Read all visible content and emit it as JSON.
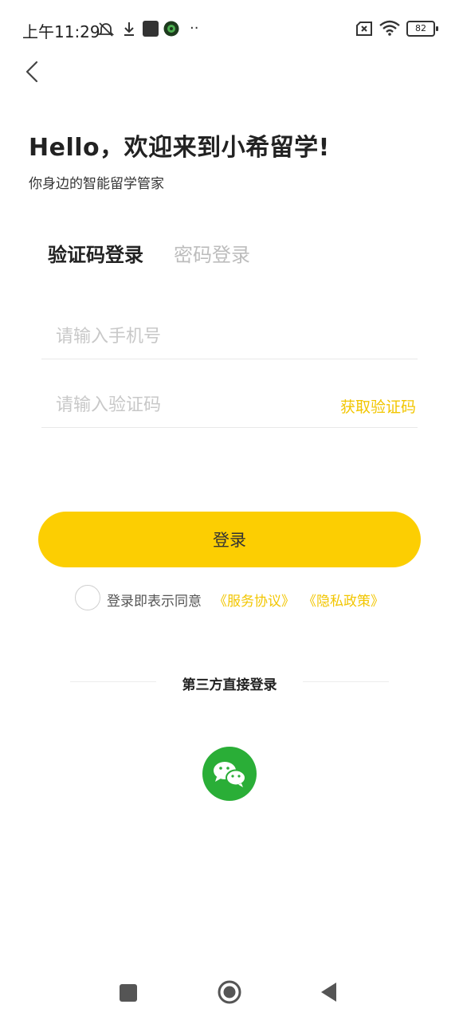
{
  "status_bar": {
    "time": "上午11:29",
    "battery": "82"
  },
  "header": {
    "title": "Hello，欢迎来到小希留学!",
    "subtitle": "你身边的智能留学管家"
  },
  "tabs": [
    {
      "label": "验证码登录",
      "active": true
    },
    {
      "label": "密码登录",
      "active": false
    }
  ],
  "form": {
    "phone_placeholder": "请输入手机号",
    "code_placeholder": "请输入验证码",
    "get_code_label": "获取验证码",
    "login_label": "登录"
  },
  "agreement": {
    "text": "登录即表示同意",
    "service_link": "《服务协议》",
    "privacy_link": "《隐私政策》"
  },
  "third_party": {
    "title": "第三方直接登录"
  },
  "colors": {
    "accent": "#fcce02",
    "link": "#f2c600",
    "wechat": "#2aae37"
  }
}
